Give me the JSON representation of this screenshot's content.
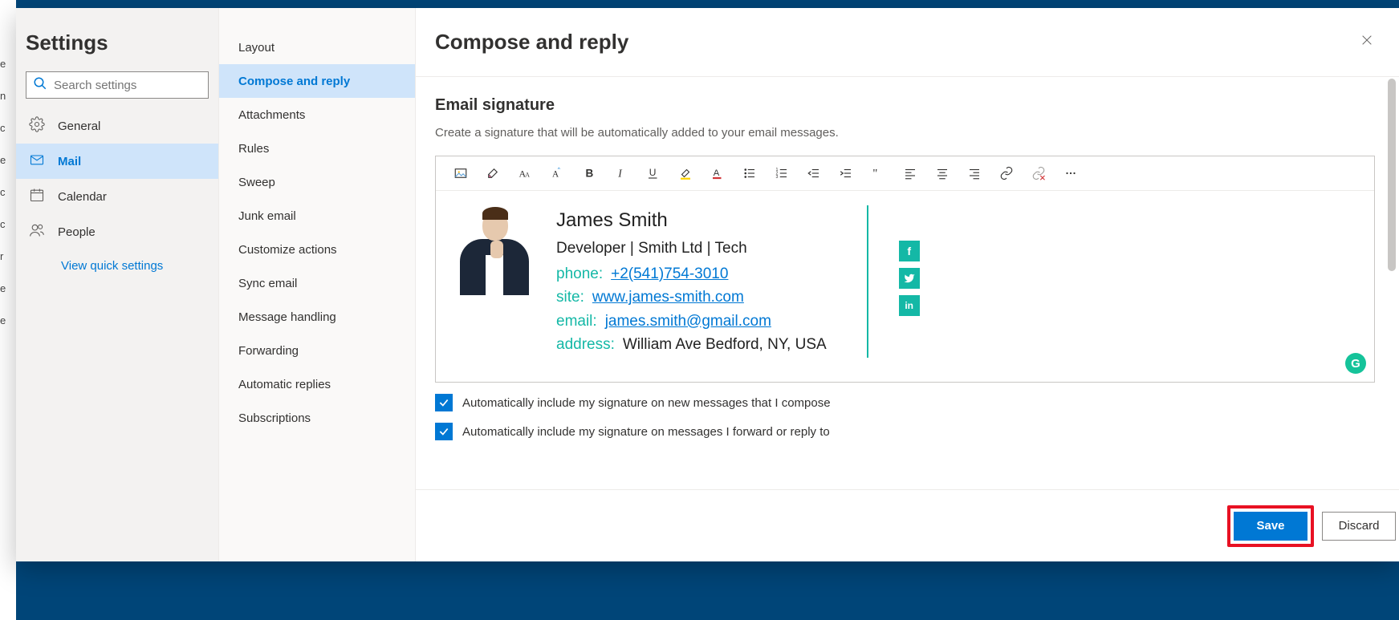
{
  "sidebar": {
    "title": "Settings",
    "search_placeholder": "Search settings",
    "items": [
      {
        "label": "General"
      },
      {
        "label": "Mail"
      },
      {
        "label": "Calendar"
      },
      {
        "label": "People"
      }
    ],
    "quick_link": "View quick settings"
  },
  "subnav": {
    "items": [
      {
        "label": "Layout"
      },
      {
        "label": "Compose and reply"
      },
      {
        "label": "Attachments"
      },
      {
        "label": "Rules"
      },
      {
        "label": "Sweep"
      },
      {
        "label": "Junk email"
      },
      {
        "label": "Customize actions"
      },
      {
        "label": "Sync email"
      },
      {
        "label": "Message handling"
      },
      {
        "label": "Forwarding"
      },
      {
        "label": "Automatic replies"
      },
      {
        "label": "Subscriptions"
      }
    ]
  },
  "main": {
    "title": "Compose and reply",
    "section_title": "Email signature",
    "section_desc": "Create a signature that will be automatically added to your email messages.",
    "signature": {
      "name": "James Smith",
      "role": "Developer | Smith Ltd | Tech",
      "phone_label": "phone:",
      "phone": "+2(541)754-3010",
      "site_label": "site:",
      "site": "www.james-smith.com",
      "email_label": "email:",
      "email": "james.smith@gmail.com",
      "address_label": "address:",
      "address": "William Ave Bedford, NY, USA",
      "socials": {
        "fb": "f",
        "tw": "t",
        "li": "in"
      }
    },
    "check1": "Automatically include my signature on new messages that I compose",
    "check2": "Automatically include my signature on messages I forward or reply to",
    "save_label": "Save",
    "discard_label": "Discard"
  }
}
